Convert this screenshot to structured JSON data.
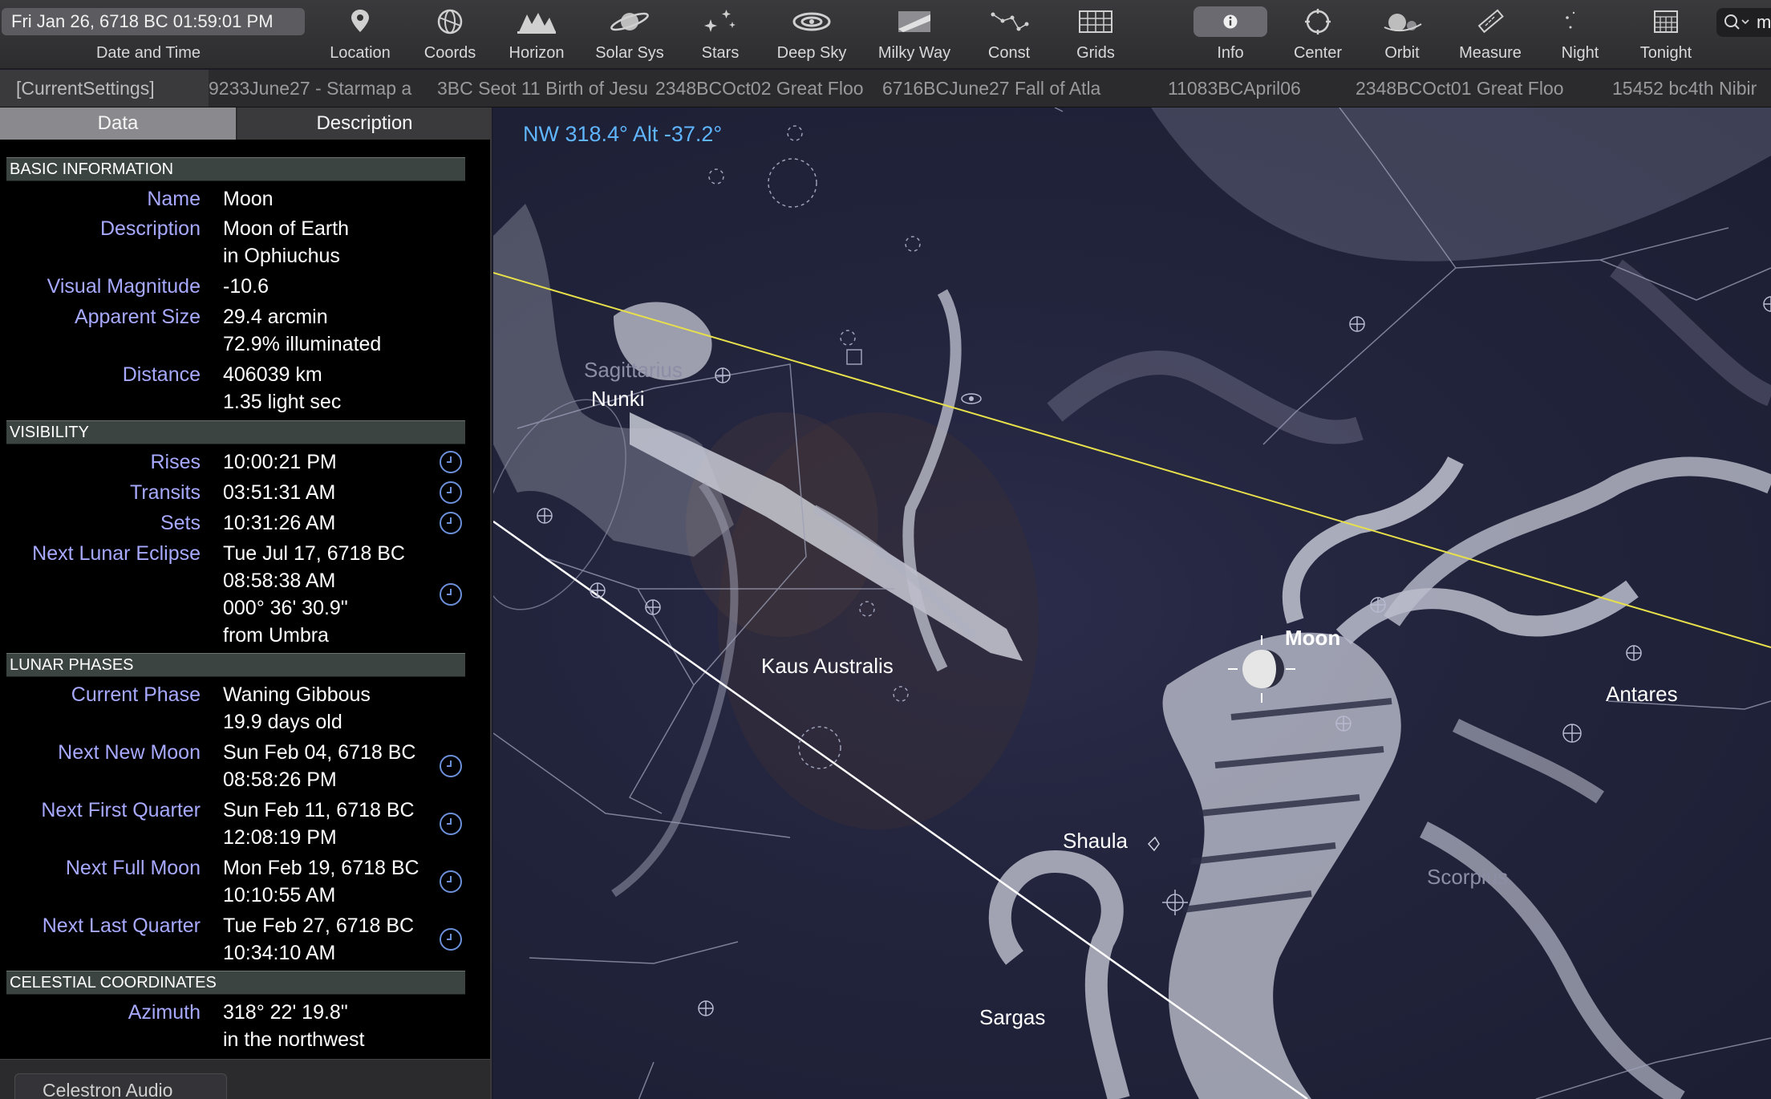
{
  "toolbar": {
    "date_time_value": "Fri Jan 26, 6718 BC 01:59:01 PM",
    "date_time_label": "Date and Time",
    "buttons": [
      {
        "label": "Location",
        "icon": "location-pin-icon"
      },
      {
        "label": "Coords",
        "icon": "coords-icon"
      },
      {
        "label": "Horizon",
        "icon": "horizon-icon"
      },
      {
        "label": "Solar Sys",
        "icon": "planet-icon"
      },
      {
        "label": "Stars",
        "icon": "stars-icon"
      },
      {
        "label": "Deep Sky",
        "icon": "galaxy-icon"
      },
      {
        "label": "Milky Way",
        "icon": "milky-way-icon"
      },
      {
        "label": "Const",
        "icon": "constellation-icon"
      },
      {
        "label": "Grids",
        "icon": "grid-icon"
      },
      {
        "label": "Info",
        "icon": "info-icon"
      },
      {
        "label": "Center",
        "icon": "center-icon"
      },
      {
        "label": "Orbit",
        "icon": "orbit-icon"
      },
      {
        "label": "Measure",
        "icon": "ruler-icon"
      },
      {
        "label": "Night",
        "icon": "moon-icon"
      },
      {
        "label": "Tonight",
        "icon": "calendar-icon"
      }
    ],
    "search_text": "m"
  },
  "tabs": {
    "current": "[CurrentSettings]",
    "items": [
      "9233June27 - Starmap a",
      "3BC Seot 11 Birth of Jesu",
      "2348BCOct02 Great Floo",
      "6716BCJune27 Fall of Atla",
      "11083BCApril06",
      "2348BCOct01 Great Floo",
      "15452 bc4th Nibir"
    ]
  },
  "panel": {
    "tab_data": "Data",
    "tab_description": "Description",
    "sections": {
      "basic": "BASIC INFORMATION",
      "visibility": "VISIBILITY",
      "lunar": "LUNAR PHASES",
      "celestial": "CELESTIAL COORDINATES"
    },
    "basic": {
      "name_label": "Name",
      "name": "Moon",
      "description_label": "Description",
      "description_1": "Moon of Earth",
      "description_2": "in Ophiuchus",
      "magnitude_label": "Visual Magnitude",
      "magnitude": "-10.6",
      "size_label": "Apparent Size",
      "size_1": "29.4 arcmin",
      "size_2": "72.9% illuminated",
      "distance_label": "Distance",
      "distance_1": "406039 km",
      "distance_2": "1.35 light sec"
    },
    "visibility": {
      "rises_label": "Rises",
      "rises": "10:00:21 PM",
      "transits_label": "Transits",
      "transits": "03:51:31 AM",
      "sets_label": "Sets",
      "sets": "10:31:26 AM",
      "eclipse_label": "Next Lunar Eclipse",
      "eclipse_1": "Tue Jul 17, 6718 BC",
      "eclipse_2": "08:58:38 AM",
      "eclipse_3": "000° 36' 30.9\"",
      "eclipse_4": "from Umbra"
    },
    "lunar": {
      "phase_label": "Current Phase",
      "phase_1": "Waning Gibbous",
      "phase_2": "19.9 days old",
      "new_label": "Next New Moon",
      "new_1": "Sun Feb 04, 6718 BC",
      "new_2": "08:58:26 PM",
      "first_label": "Next First Quarter",
      "first_1": "Sun Feb 11, 6718 BC",
      "first_2": "12:08:19 PM",
      "full_label": "Next Full Moon",
      "full_1": "Mon Feb 19, 6718 BC",
      "full_2": "10:10:55 AM",
      "last_label": "Next Last Quarter",
      "last_1": "Tue Feb 27, 6718 BC",
      "last_2": "10:34:10 AM"
    },
    "celestial": {
      "azimuth_label": "Azimuth",
      "azimuth_1": "318° 22' 19.8\"",
      "azimuth_2": "in the northwest"
    },
    "bottom_tab": "Celestron Audio"
  },
  "sky": {
    "readout": "NW 318.4° Alt -37.2°",
    "labels": {
      "sagittarius": "Sagittarius",
      "nunki": "Nunki",
      "kaus_australis": "Kaus Australis",
      "moon": "Moon",
      "antares": "Antares",
      "shaula": "Shaula",
      "scorpius": "Scorpius",
      "sargas": "Sargas"
    },
    "colors": {
      "ecliptic": "#e8e04a",
      "horizon": "#ffffff",
      "readout": "#5fb6ff",
      "panel_label": "#a7a9ff"
    }
  }
}
